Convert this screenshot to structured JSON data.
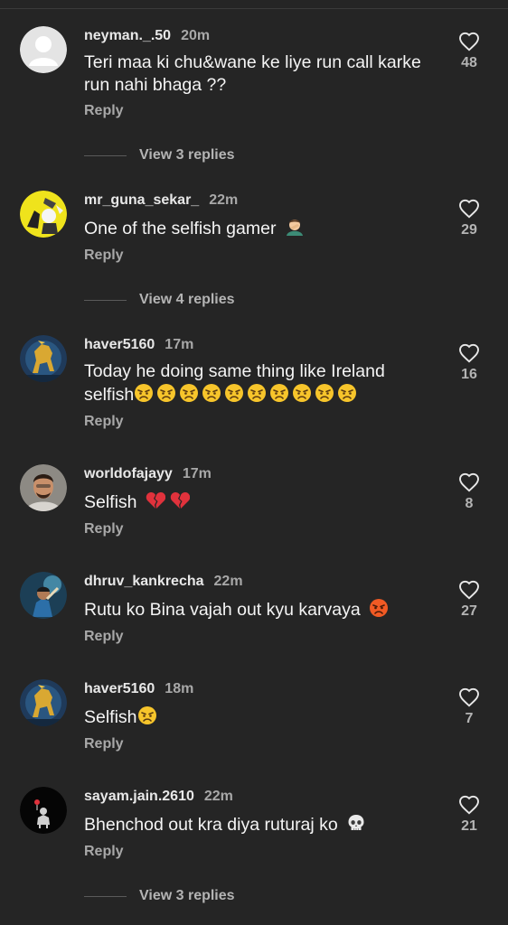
{
  "comments": [
    {
      "username": "neyman._.50",
      "time": "20m",
      "text_line1": "Teri maa ki chu&wane ke liye run call karke",
      "text_line2": "run nahi bhaga ??",
      "reply_label": "Reply",
      "likes": "48",
      "view_replies": "View 3 replies",
      "avatar": "default-avatar-icon"
    },
    {
      "username": "mr_guna_sekar_",
      "time": "22m",
      "text": "One of the selfish gamer",
      "emoji": "man-facepalming-emoji",
      "reply_label": "Reply",
      "likes": "29",
      "view_replies": "View 4 replies",
      "avatar": "yellow-cartoon-avatar"
    },
    {
      "username": "haver5160",
      "time": "17m",
      "text_line1": "Today he doing same thing like Ireland",
      "text_line2": "selfish",
      "emoji": "angry-face-emoji",
      "emoji_count": 10,
      "reply_label": "Reply",
      "likes": "16",
      "avatar": "golden-horse-avatar"
    },
    {
      "username": "worldofajayy",
      "time": "17m",
      "text": "Selfish",
      "emoji": "broken-heart-emoji",
      "emoji_count": 2,
      "reply_label": "Reply",
      "likes": "8",
      "avatar": "man-photo-avatar"
    },
    {
      "username": "dhruv_kankrecha",
      "time": "22m",
      "text": "Rutu ko Bina vajah out kyu karvaya",
      "emoji": "pouting-face-emoji",
      "reply_label": "Reply",
      "likes": "27",
      "avatar": "cricketer-avatar"
    },
    {
      "username": "haver5160",
      "time": "18m",
      "text": "Selfish",
      "emoji": "angry-face-emoji",
      "reply_label": "Reply",
      "likes": "7",
      "avatar": "golden-horse-avatar"
    },
    {
      "username": "sayam.jain.2610",
      "time": "22m",
      "text": "Bhenchod out kra diya ruturaj ko",
      "emoji": "skull-emoji",
      "reply_label": "Reply",
      "likes": "21",
      "view_replies": "View 3 replies",
      "avatar": "dark-figure-avatar"
    }
  ],
  "colors": {
    "background": "#252525",
    "text": "#f4f4f4",
    "secondary": "#a8a8a8",
    "angry_emoji": "#f7c52b",
    "pouting_emoji": "#f15a24",
    "broken_heart": "#e0323c"
  }
}
